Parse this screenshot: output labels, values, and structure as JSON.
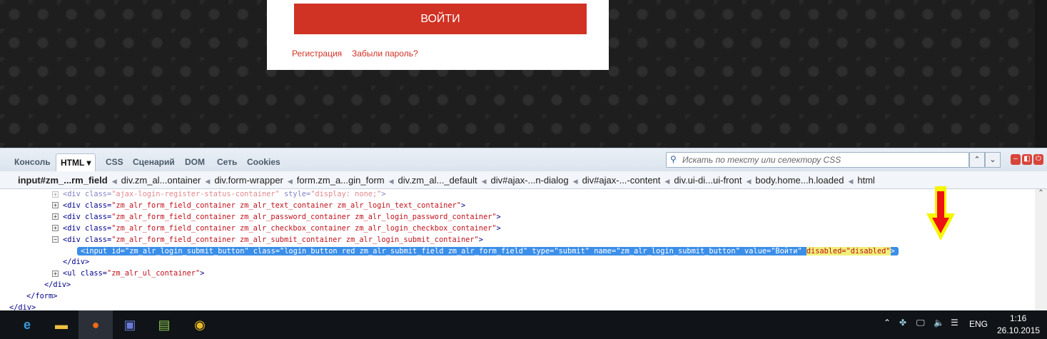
{
  "page": {
    "login_button": "ВОЙТИ",
    "register_link": "Регистрация",
    "forgot_link": "Забыли пароль?"
  },
  "devtools": {
    "tabs": [
      "Консоль",
      "HTML ▾",
      "CSS",
      "Сценарий",
      "DOM",
      "Сеть",
      "Cookies"
    ],
    "active_tab": 1,
    "search_placeholder": "Искать по тексту или селектору CSS",
    "breadcrumbs": [
      "input#zm_...rm_field",
      "div.zm_al...ontainer",
      "div.form-wrapper",
      "form.zm_a...gin_form",
      "div.zm_al..._default",
      "div#ajax-...n-dialog",
      "div#ajax-...-content",
      "div.ui-di...ui-front",
      "body.home...h.loaded",
      "html"
    ],
    "code_lines": [
      {
        "indent": 73,
        "toggle": "+",
        "dim": true,
        "tokens": [
          [
            "t",
            "<div "
          ],
          [
            "a",
            "class="
          ],
          [
            "v",
            "\"ajax-login-register-status-container\""
          ],
          [
            "a",
            " style="
          ],
          [
            "v",
            "\"display: none;\""
          ],
          [
            "t",
            ">"
          ]
        ]
      },
      {
        "indent": 73,
        "toggle": "+",
        "tokens": [
          [
            "t",
            "<div "
          ],
          [
            "a",
            "class="
          ],
          [
            "v",
            "\"zm_alr_form_field_container zm_alr_text_container zm_alr_login_text_container\""
          ],
          [
            "t",
            ">"
          ]
        ]
      },
      {
        "indent": 73,
        "toggle": "+",
        "tokens": [
          [
            "t",
            "<div "
          ],
          [
            "a",
            "class="
          ],
          [
            "v",
            "\"zm_alr_form_field_container zm_alr_password_container zm_alr_login_password_container\""
          ],
          [
            "t",
            ">"
          ]
        ]
      },
      {
        "indent": 73,
        "toggle": "+",
        "tokens": [
          [
            "t",
            "<div "
          ],
          [
            "a",
            "class="
          ],
          [
            "v",
            "\"zm_alr_form_field_container zm_alr_checkbox_container zm_alr_login_checkbox_container\""
          ],
          [
            "t",
            ">"
          ]
        ]
      },
      {
        "indent": 73,
        "toggle": "-",
        "tokens": [
          [
            "t",
            "<div "
          ],
          [
            "a",
            "class="
          ],
          [
            "v",
            "\"zm_alr_form_field_container zm_alr_submit_container zm_alr_login_submit_container\""
          ],
          [
            "t",
            ">"
          ]
        ]
      },
      {
        "indent": 108,
        "selected": true,
        "tokens": [
          [
            "t",
            "<input "
          ],
          [
            "a",
            "id="
          ],
          [
            "v",
            "\"zm_alr_login_submit_button\""
          ],
          [
            "a",
            " class="
          ],
          [
            "v",
            "\"login_button red zm_alr_submit_field zm_alr_form_field\""
          ],
          [
            "a",
            " type="
          ],
          [
            "v",
            "\"submit\""
          ],
          [
            "a",
            " name="
          ],
          [
            "v",
            "\"zm_alr_login_submit_button\""
          ],
          [
            "a",
            " value="
          ],
          [
            "v",
            "\"Войти\" "
          ],
          [
            "hl",
            "disabled=\"disabled\""
          ],
          [
            "t",
            ">"
          ]
        ]
      },
      {
        "indent": 88,
        "tokens": [
          [
            "t",
            "</div>"
          ]
        ]
      },
      {
        "indent": 73,
        "toggle": "+",
        "tokens": [
          [
            "t",
            "<ul "
          ],
          [
            "a",
            "class="
          ],
          [
            "v",
            "\"zm_alr_ul_container\""
          ],
          [
            "t",
            ">"
          ]
        ]
      },
      {
        "indent": 62,
        "tokens": [
          [
            "t",
            "</div>"
          ]
        ]
      },
      {
        "indent": 37,
        "tokens": [
          [
            "t",
            "</form>"
          ]
        ]
      },
      {
        "indent": 13,
        "tokens": [
          [
            "t",
            "</div>"
          ]
        ]
      }
    ]
  },
  "taskbar": {
    "language": "ENG",
    "time": "1:16",
    "date": "26.10.2015"
  },
  "colors": {
    "accent": "#d03224",
    "selection": "#3c8fe8"
  }
}
